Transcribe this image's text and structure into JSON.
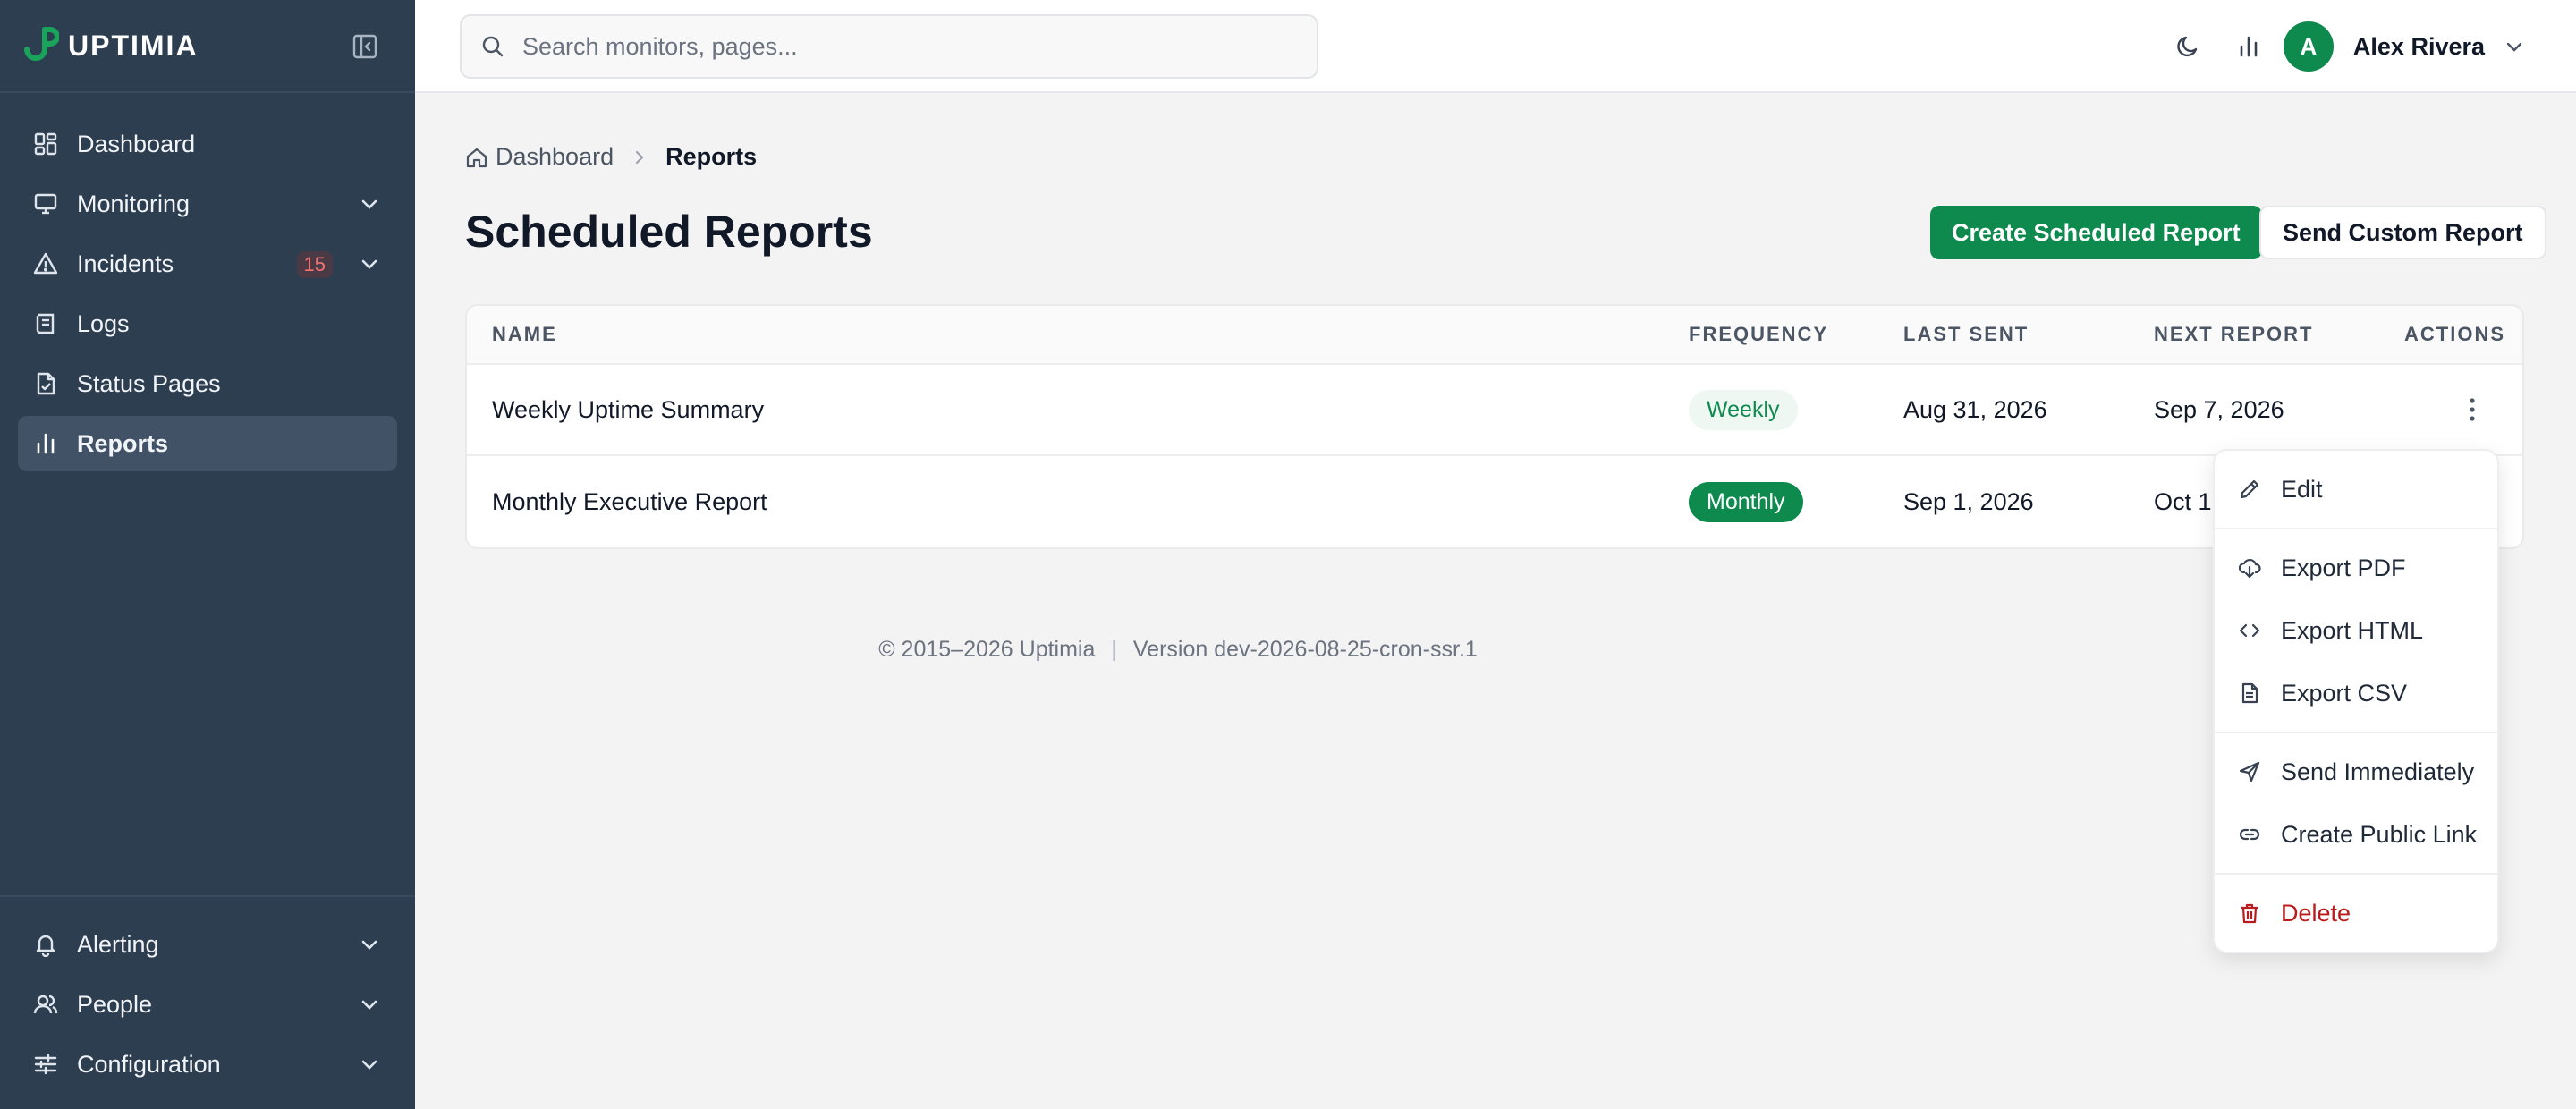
{
  "brand": {
    "name": "UPTIMIA"
  },
  "sidebar": {
    "items": [
      {
        "label": "Dashboard"
      },
      {
        "label": "Monitoring"
      },
      {
        "label": "Incidents",
        "badge": "15"
      },
      {
        "label": "Logs"
      },
      {
        "label": "Status Pages"
      },
      {
        "label": "Reports"
      }
    ],
    "bottom_items": [
      {
        "label": "Alerting"
      },
      {
        "label": "People"
      },
      {
        "label": "Configuration"
      }
    ]
  },
  "search": {
    "placeholder": "Search monitors, pages..."
  },
  "user": {
    "initial": "A",
    "name": "Alex Rivera"
  },
  "breadcrumb": {
    "home": "Dashboard",
    "current": "Reports"
  },
  "page": {
    "title": "Scheduled Reports",
    "primary_button": "Create Scheduled Report",
    "secondary_button": "Send Custom Report"
  },
  "table": {
    "headers": {
      "name": "NAME",
      "frequency": "FREQUENCY",
      "last_sent": "LAST SENT",
      "next_report": "NEXT REPORT",
      "actions": "ACTIONS"
    },
    "rows": [
      {
        "name": "Weekly Uptime Summary",
        "frequency": "Weekly",
        "last_sent": "Aug 31, 2026",
        "next_report": "Sep 7, 2026"
      },
      {
        "name": "Monthly Executive Report",
        "frequency": "Monthly",
        "last_sent": "Sep 1, 2026",
        "next_report": "Oct 1,"
      }
    ]
  },
  "footer": {
    "copyright": "© 2015–2026 Uptimia",
    "version": "Version dev-2026-08-25-cron-ssr.1"
  },
  "menu": {
    "edit": "Edit",
    "export_pdf": "Export PDF",
    "export_html": "Export HTML",
    "export_csv": "Export CSV",
    "send_immediately": "Send Immediately",
    "create_public_link": "Create Public Link",
    "delete": "Delete"
  },
  "colors": {
    "brand_green": "#0e8a4f",
    "sidebar_bg": "#2e3e51",
    "danger": "#b91c1c"
  }
}
